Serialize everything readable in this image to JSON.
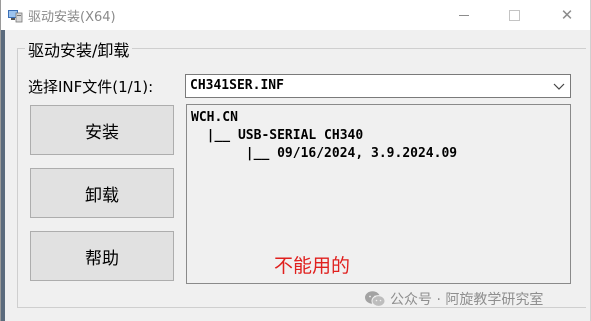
{
  "window": {
    "title": "驱动安装(X64)"
  },
  "group": {
    "legend": "驱动安装/卸载"
  },
  "inf_selector": {
    "label": "选择INF文件(1/1):",
    "selected": "CH341SER.INF"
  },
  "buttons": {
    "install": "安装",
    "uninstall": "卸载",
    "help": "帮助"
  },
  "info": {
    "lines": [
      "WCH.CN",
      "  |__ USB-SERIAL CH340",
      "       |__ 09/16/2024, 3.9.2024.09"
    ]
  },
  "annotation": "不能用的",
  "watermark": {
    "text": "公众号 · 阿旋教学研究室",
    "icon": "wechat-icon"
  },
  "colors": {
    "annotation": "#e0201e",
    "window_bg": "#f0f0f0",
    "button_bg": "#e1e1e1"
  }
}
